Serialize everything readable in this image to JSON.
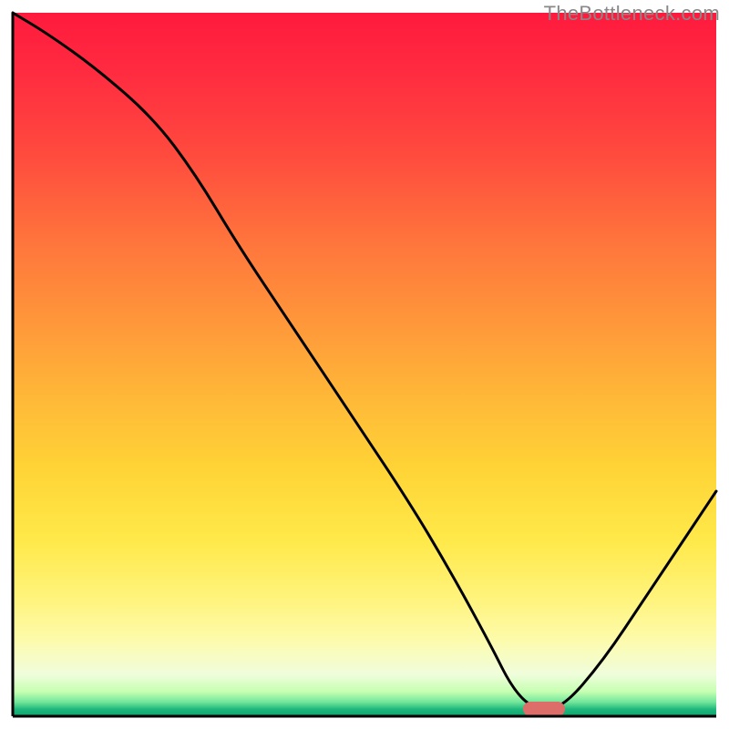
{
  "watermark": "TheBottleneck.com",
  "colors": {
    "axis": "#000000",
    "curve": "#000000",
    "marker": "#dd6d69"
  },
  "chart_data": {
    "type": "line",
    "title": "",
    "xlabel": "",
    "ylabel": "",
    "xlim": [
      0,
      100
    ],
    "ylim": [
      0,
      100
    ],
    "grid": false,
    "notes": "Background encodes bottleneck severity (red=high, green=low). Curve shows bottleneck percentage across parameter sweep; trough near x≈74 is the optimal match. Axes have no numeric tick labels.",
    "series": [
      {
        "name": "bottleneck-curve",
        "x": [
          0,
          5,
          12,
          20,
          26,
          32,
          40,
          48,
          56,
          62,
          68,
          71,
          74,
          78,
          84,
          90,
          96,
          100
        ],
        "values": [
          100,
          97,
          92,
          85,
          77,
          67,
          55,
          43,
          31,
          21,
          10,
          4,
          1,
          1,
          8,
          17,
          26,
          32
        ]
      }
    ],
    "marker": {
      "x": 75.5,
      "y": 1
    }
  }
}
